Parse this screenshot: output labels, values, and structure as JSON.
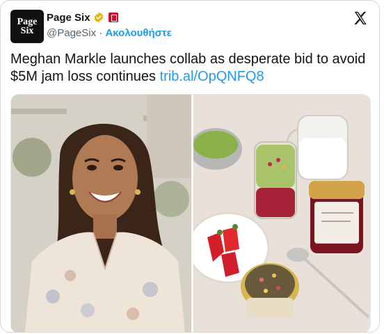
{
  "account": {
    "avatar_line1": "Page",
    "avatar_line2": "Six",
    "name": "Page Six",
    "handle": "@PageSix",
    "separator": "·",
    "follow_label": "Ακολουθήστε"
  },
  "tweet": {
    "text": "Meghan Markle launches collab as desperate bid to avoid $5M jam loss continues",
    "link": "trib.al/OpQNFQ8"
  },
  "icons": {
    "verified": "verified-badge-icon",
    "affiliate": "affiliate-badge-icon",
    "platform": "x-logo-icon"
  },
  "colors": {
    "accent": "#1d9bf0",
    "verified_gold": "#e2b719",
    "affiliate_red": "#c8102e",
    "text_primary": "#0f1419",
    "text_secondary": "#536471"
  }
}
